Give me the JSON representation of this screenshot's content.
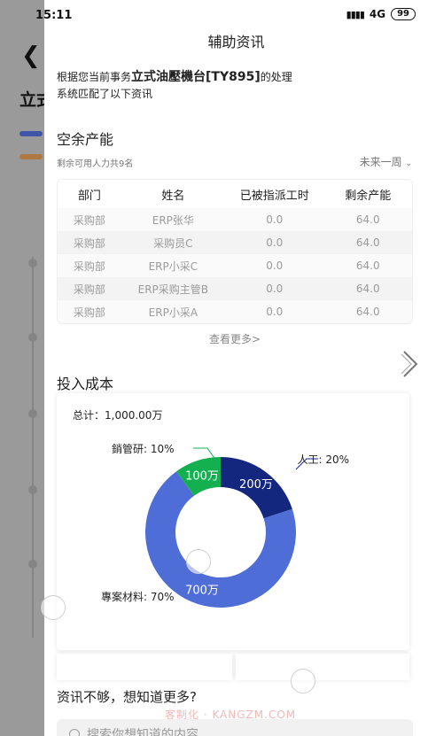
{
  "status_bar": {
    "time": "15:11",
    "network": "4G",
    "battery": "99"
  },
  "background": {
    "page_title": "立式"
  },
  "panel": {
    "title": "辅助资讯",
    "intro": {
      "prefix": "根据您当前事务",
      "highlight": "立式油壓機台[TY895]",
      "suffix": "的处理",
      "line2": "系统匹配了以下资讯"
    }
  },
  "capacity": {
    "title": "空余产能",
    "summary": "剩余可用人力共9名",
    "filter": "未来一周",
    "columns": [
      "部门",
      "姓名",
      "已被指派工时",
      "剩余产能"
    ],
    "rows": [
      [
        "采购部",
        "ERP张华",
        "0.0",
        "64.0"
      ],
      [
        "采购部",
        "采购员C",
        "0.0",
        "64.0"
      ],
      [
        "采购部",
        "ERP小采C",
        "0.0",
        "64.0"
      ],
      [
        "采购部",
        "ERP采购主管B",
        "0.0",
        "64.0"
      ],
      [
        "采购部",
        "ERP小采A",
        "0.0",
        "64.0"
      ]
    ],
    "more_label": "查看更多>"
  },
  "cost": {
    "title": "投入成本",
    "total": "总计：1,000.00万"
  },
  "chart_data": {
    "type": "pie",
    "total": "1,000.00万",
    "slices": [
      {
        "name": "人工",
        "percent": 20,
        "value_label": "200万",
        "color": "#14277f",
        "label": "人工: 20%"
      },
      {
        "name": "專案材料",
        "percent": 70,
        "value_label": "700万",
        "color": "#4f6dd6",
        "label": "專案材料: 70%"
      },
      {
        "name": "銷管研",
        "percent": 10,
        "value_label": "100万",
        "color": "#14b050",
        "label": "銷管研: 10%"
      }
    ]
  },
  "bottom": {
    "ask": "资讯不够，想知道更多?",
    "watermark": "客制化 · KANGZM.COM",
    "search_placeholder": "搜索你想知道的内容"
  }
}
